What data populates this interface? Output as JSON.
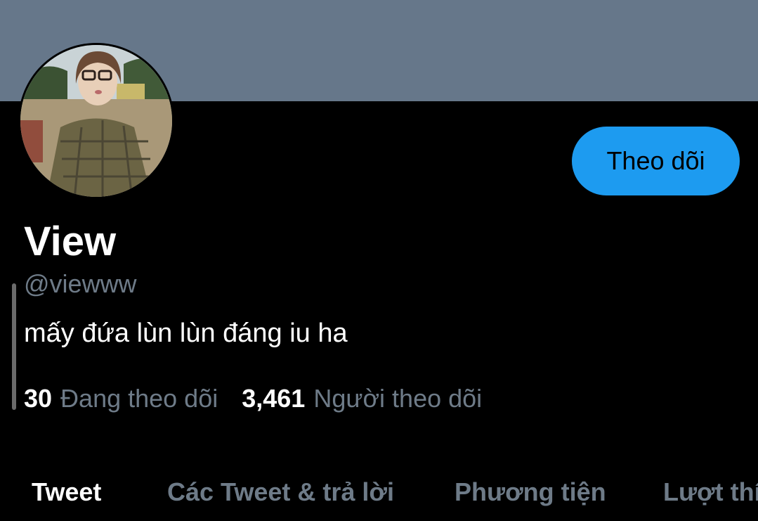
{
  "profile": {
    "display_name": "View",
    "handle": "@viewww",
    "bio": "mấy đứa lùn lùn đáng iu ha",
    "follow_label": "Theo dõi",
    "following_count": "30",
    "following_label": "Đang theo dõi",
    "followers_count": "3,461",
    "followers_label": "Người theo dõi"
  },
  "tabs": [
    {
      "label": "Tweet",
      "active": true
    },
    {
      "label": "Các Tweet & trả lời",
      "active": false
    },
    {
      "label": "Phương tiện",
      "active": false
    },
    {
      "label": "Lượt thích",
      "active": false
    }
  ],
  "colors": {
    "banner": "#66778a",
    "accent": "#1d9bf0",
    "background": "#000000",
    "secondary_text": "#6e7b88"
  }
}
